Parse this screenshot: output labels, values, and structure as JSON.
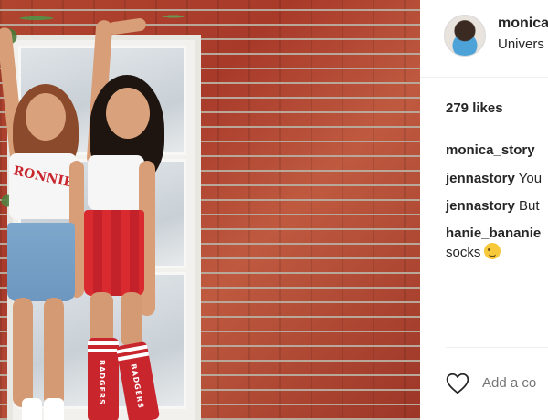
{
  "post": {
    "username": "monica",
    "location": "Univers",
    "likes": "279 likes",
    "comments": [
      {
        "user": "monica_story",
        "text": ""
      },
      {
        "user": "jennastory",
        "text": "You"
      },
      {
        "user": "jennastory",
        "text": "But"
      },
      {
        "user": "hanie_bananie",
        "text": "",
        "continuation": "socks",
        "emoji": "winking-face"
      }
    ],
    "add_comment_placeholder": "Add a co"
  },
  "photo": {
    "shirt_text": "RONNIE",
    "sock_text_left": "BADGERS",
    "sock_text_right": "BADGERS"
  },
  "colors": {
    "brick": "#a83a2a",
    "skirt_red": "#d92a2f",
    "denim": "#7ea7cc",
    "text": "#262626",
    "muted": "#999999"
  }
}
